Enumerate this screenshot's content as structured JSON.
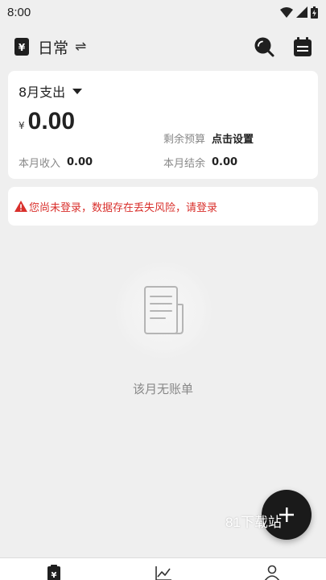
{
  "status_bar": {
    "time": "8:00",
    "icons": [
      "wifi-icon",
      "signal-icon",
      "battery-icon"
    ]
  },
  "app_bar": {
    "book_name": "日常",
    "swap_symbol": "⇌",
    "icons": [
      "ledger-book-icon",
      "swap-icon",
      "search-icon",
      "calendar-icon"
    ]
  },
  "summary": {
    "month_label": "8月支出",
    "currency": "¥",
    "expense": "0.00",
    "budget_label": "剩余预算",
    "budget_action": "点击设置",
    "income_label": "本月收入",
    "income_value": "0.00",
    "balance_label": "本月结余",
    "balance_value": "0.00"
  },
  "warning": {
    "text": "您尚未登录，数据存在丢失风险，请登录",
    "color": "#d9302c"
  },
  "empty_state": {
    "text": "该月无账单",
    "icon": "receipt-icon"
  },
  "watermark": "81下载站",
  "fab": {
    "icon": "plus-icon"
  },
  "bottom_nav": {
    "items": [
      "ledger-nav-icon",
      "chart-nav-icon",
      "profile-nav-icon"
    ]
  },
  "colors": {
    "background": "#efefef",
    "card": "#ffffff",
    "fab": "#1a1a1a",
    "warning": "#d9302c"
  }
}
